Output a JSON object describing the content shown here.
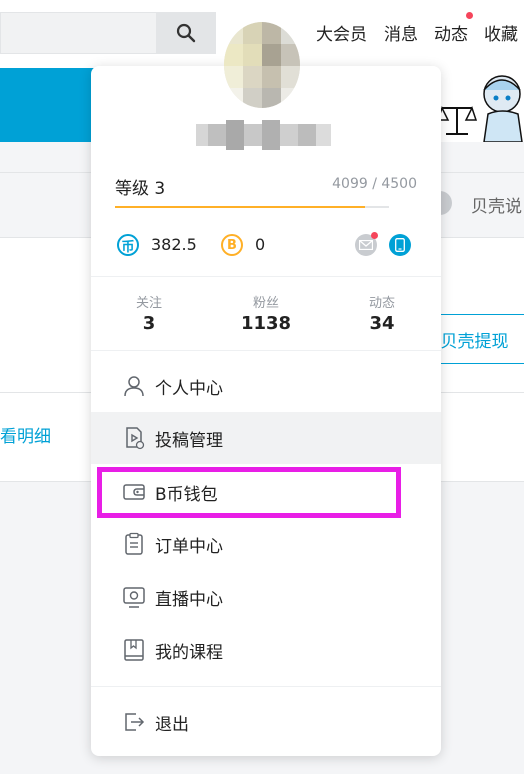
{
  "header": {
    "nav": [
      {
        "label": "大会员",
        "name": "nav-vip"
      },
      {
        "label": "消息",
        "name": "nav-messages"
      },
      {
        "label": "动态",
        "name": "nav-dynamics"
      },
      {
        "label": "收藏",
        "name": "nav-favorites"
      }
    ],
    "search_icon": "search-icon"
  },
  "background": {
    "shell_label": "贝壳说",
    "withdraw_label": "贝壳提现",
    "detail_link": "看明细"
  },
  "panel": {
    "level_label": "等级 3",
    "level_progress_text": "4099 / 4500",
    "level_progress": 0.911,
    "coins": {
      "value": "382.5",
      "icon": "coin-icon"
    },
    "bcoin": {
      "value": "0",
      "icon": "b-coin-icon"
    },
    "stats": [
      {
        "label": "关注",
        "value": "3"
      },
      {
        "label": "粉丝",
        "value": "1138"
      },
      {
        "label": "动态",
        "value": "34"
      }
    ],
    "menu": [
      {
        "label": "个人中心",
        "icon": "user-icon"
      },
      {
        "label": "投稿管理",
        "icon": "upload-icon"
      },
      {
        "label": "B币钱包",
        "icon": "wallet-icon"
      },
      {
        "label": "订单中心",
        "icon": "order-icon"
      },
      {
        "label": "直播中心",
        "icon": "live-icon"
      },
      {
        "label": "我的课程",
        "icon": "course-icon"
      }
    ],
    "logout_label": "退出"
  },
  "colors": {
    "accent": "#00a1d6",
    "highlight": "#e81ee6",
    "level": "#ffb027",
    "badge": "#f5455b"
  }
}
